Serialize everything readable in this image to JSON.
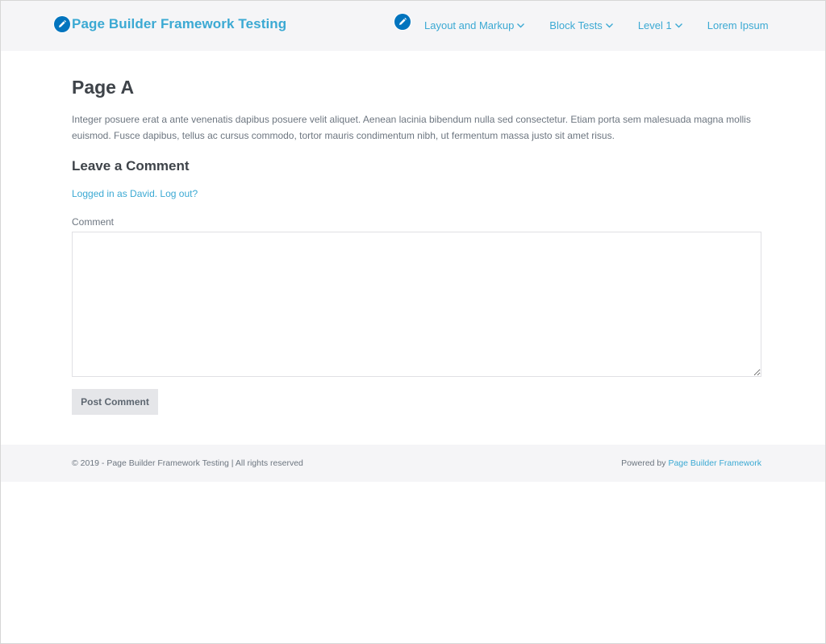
{
  "header": {
    "site_title": "Page Builder Framework Testing",
    "nav": [
      {
        "label": "Layout and Markup",
        "has_dropdown": true
      },
      {
        "label": "Block Tests",
        "has_dropdown": true
      },
      {
        "label": "Level 1",
        "has_dropdown": true
      },
      {
        "label": "Lorem Ipsum",
        "has_dropdown": false
      }
    ]
  },
  "main": {
    "page_title": "Page A",
    "intro": "Integer posuere erat a ante venenatis dapibus posuere velit aliquet. Aenean lacinia bibendum nulla sed consectetur. Etiam porta sem malesuada magna mollis euismod. Fusce dapibus, tellus ac cursus commodo, tortor mauris condimentum nibh, ut fermentum massa justo sit amet risus.",
    "comments": {
      "heading": "Leave a Comment",
      "logged_in_link": "Logged in as David.",
      "logout_link": "Log out?",
      "comment_label": "Comment",
      "comment_value": "",
      "submit_label": "Post Comment"
    }
  },
  "footer": {
    "copyright": "© 2019 - Page Builder Framework Testing | All rights reserved",
    "powered_prefix": "Powered by",
    "powered_link": "Page Builder Framework"
  },
  "colors": {
    "accent": "#3ba9d3",
    "edit_badge": "#0274be",
    "bar_background": "#f5f5f7",
    "heading": "#3e4349",
    "body_text": "#6d7680",
    "button_background": "#e5e6e9"
  },
  "icons": {
    "edit": "pencil-icon",
    "dropdown": "chevron-down-icon"
  }
}
